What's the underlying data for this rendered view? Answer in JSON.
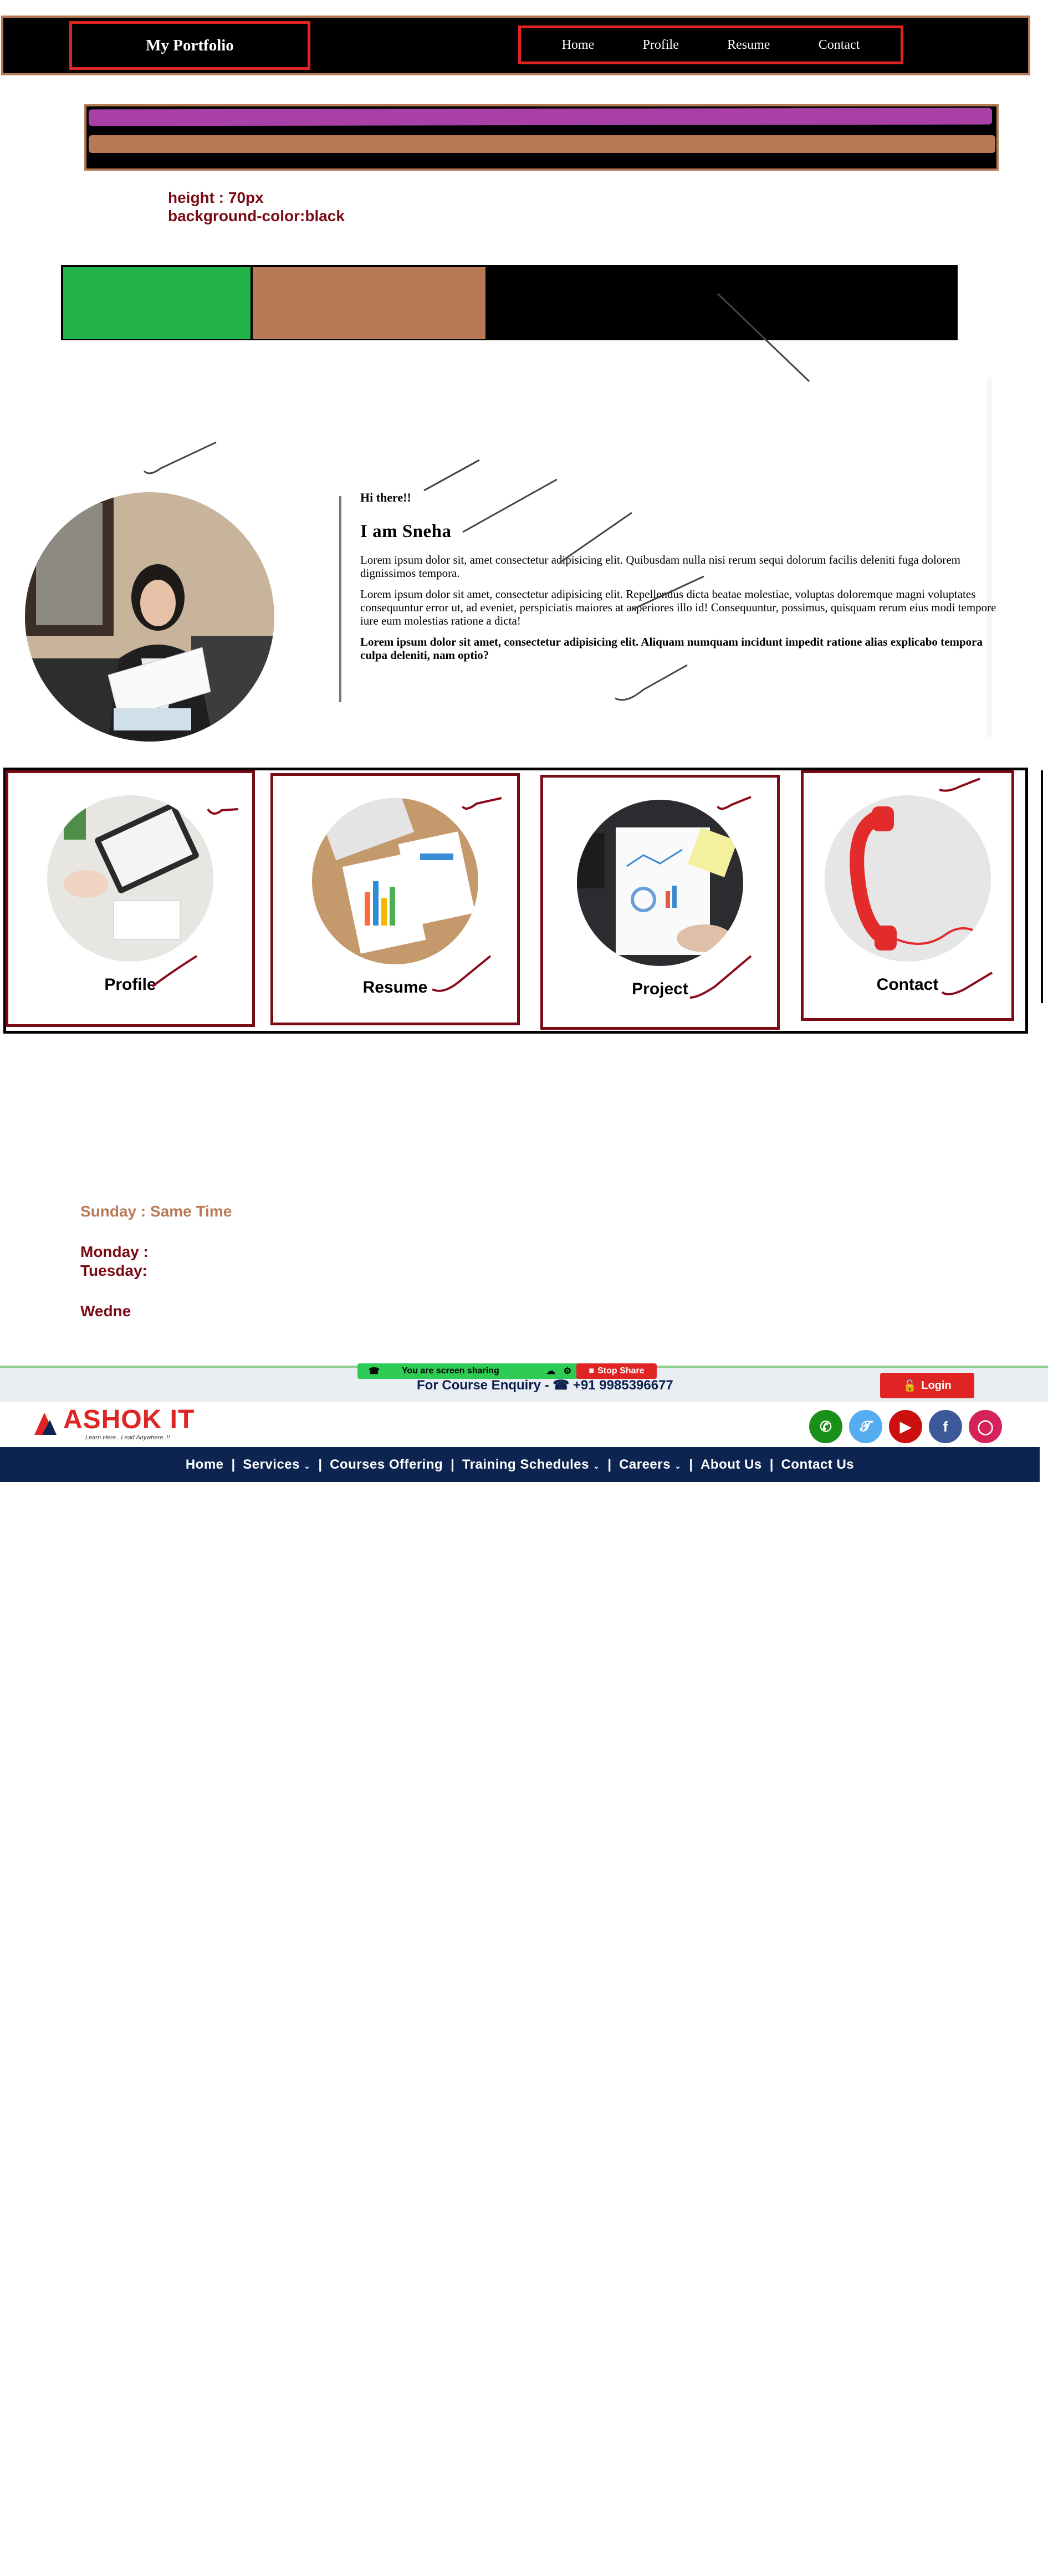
{
  "portfolio": {
    "brand": "My Portfolio",
    "nav": [
      "Home",
      "Profile",
      "Resume",
      "Contact"
    ]
  },
  "note": {
    "line1": "height : 70px",
    "line2": "background-color:black"
  },
  "about": {
    "greeting": "Hi there!!",
    "name": "I am Sneha",
    "para1": "Lorem ipsum dolor sit, amet consectetur adipisicing elit. Quibusdam nulla nisi rerum sequi dolorum facilis deleniti fuga dolorem dignissimos tempora.",
    "para2": "Lorem ipsum dolor sit amet, consectetur adipisicing elit. Repellendus dicta beatae molestiae, voluptas doloremque magni voluptates consequuntur error ut, ad eveniet, perspiciatis maiores at asperiores illo id! Consequuntur, possimus, quisquam rerum eius modi tempore iure eum molestias ratione a dicta!",
    "para3": "Lorem ipsum dolor sit amet, consectetur adipisicing elit. Aliquam numquam incidunt impedit ratione alias explicabo tempora culpa deleniti, nam optio?"
  },
  "cards": [
    "Profile",
    "Resume",
    "Project",
    "Contact"
  ],
  "schedule": {
    "sunday": "Sunday :  Same Time",
    "monday": "Monday :",
    "tuesday": "Tuesday:",
    "wednesday": "Wedne"
  },
  "screen_share": {
    "message": "You are screen sharing",
    "stop": "Stop Share"
  },
  "site": {
    "enquiry": "For Course Enquiry -  ☎ +91 9985396677",
    "login": "Login",
    "logo_text": "ASHOK IT",
    "logo_tagline": "Learn Here.. Lead Anywhere..!!",
    "nav": [
      "Home",
      "Services",
      "Courses Offering",
      "Training Schedules",
      "Careers",
      "About Us",
      "Contact Us"
    ],
    "social": [
      {
        "icon": "whatsapp-icon",
        "color": "#1a8f1a"
      },
      {
        "icon": "twitter-icon",
        "color": "#55acee"
      },
      {
        "icon": "youtube-icon",
        "color": "#cc1010"
      },
      {
        "icon": "facebook-icon",
        "color": "#3b5998"
      },
      {
        "icon": "instagram-icon",
        "color": "#d6225a"
      }
    ]
  },
  "colors": {
    "accent_red": "#e02424",
    "maroon": "#7a0a14",
    "copper": "#b87a55",
    "navy": "#0d2450"
  }
}
